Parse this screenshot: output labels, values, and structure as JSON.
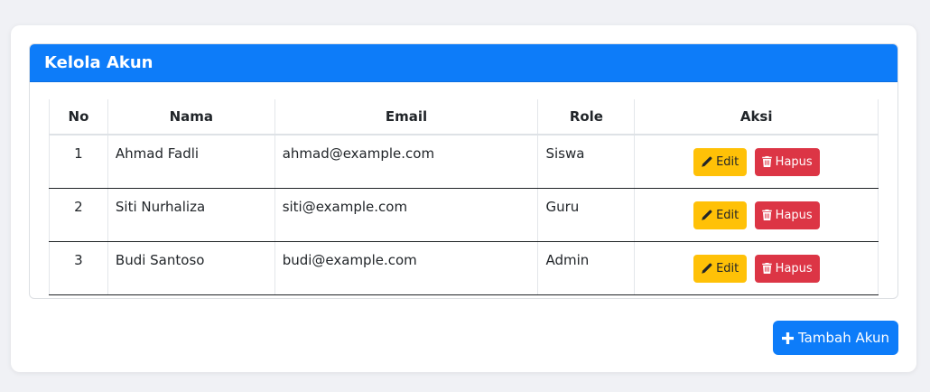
{
  "card": {
    "title": "Kelola Akun"
  },
  "table": {
    "headers": [
      "No",
      "Nama",
      "Email",
      "Role",
      "Aksi"
    ],
    "rows": [
      {
        "no": "1",
        "nama": "Ahmad Fadli",
        "email": "ahmad@example.com",
        "role": "Siswa"
      },
      {
        "no": "2",
        "nama": "Siti Nurhaliza",
        "email": "siti@example.com",
        "role": "Guru"
      },
      {
        "no": "3",
        "nama": "Budi Santoso",
        "email": "budi@example.com",
        "role": "Admin"
      }
    ],
    "edit_label": "Edit",
    "delete_label": "Hapus"
  },
  "actions": {
    "add_label": "Tambah Akun"
  },
  "icons": {
    "edit": "pencil-icon",
    "delete": "trash-icon",
    "add": "plus-icon"
  },
  "colors": {
    "primary": "#0d7cf9",
    "warning": "#ffc107",
    "danger": "#dc3545",
    "background": "#f0f1f5"
  }
}
